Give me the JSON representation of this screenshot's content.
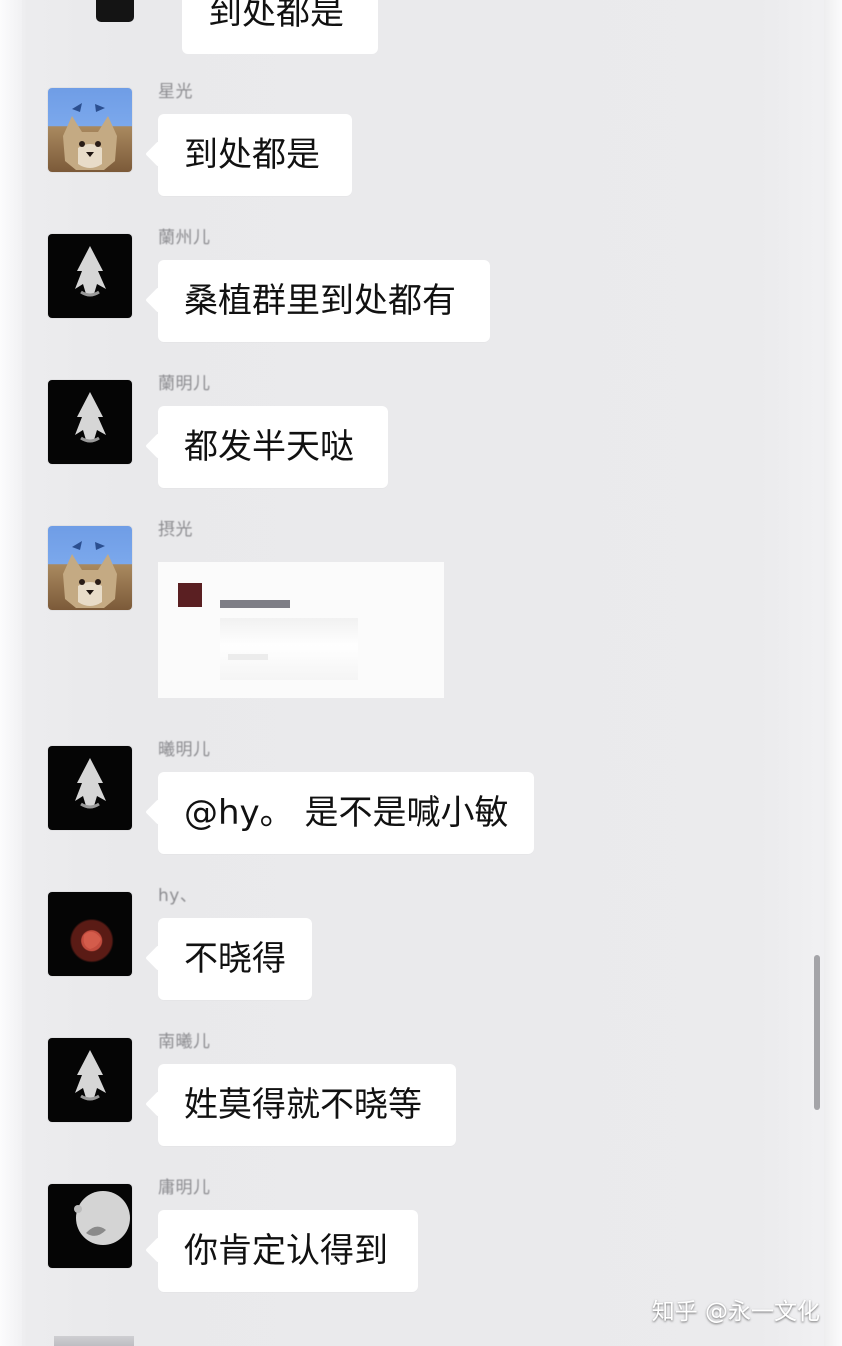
{
  "chat": {
    "partial_top_message": {
      "text": "到处都是"
    },
    "messages": [
      {
        "sender": "星光",
        "text": "到处都是",
        "avatar_icon": "dog-avatar-icon"
      },
      {
        "sender": "蘭州儿",
        "text": "桑植群里到处都有",
        "avatar_icon": "hooded-figure-avatar-icon"
      },
      {
        "sender": "蘭明儿",
        "text": "都发半天哒",
        "avatar_icon": "hooded-figure-avatar-icon"
      },
      {
        "sender": "摂光",
        "text": "",
        "avatar_icon": "dog-avatar-icon",
        "type": "image"
      },
      {
        "sender": "曦明儿",
        "text": "@hy。 是不是喊小敏",
        "avatar_icon": "hooded-figure-avatar-icon"
      },
      {
        "sender": "hy、",
        "text": "不晓得",
        "avatar_icon": "red-glow-avatar-icon"
      },
      {
        "sender": "南曦儿",
        "text": "姓莫得就不晓等",
        "avatar_icon": "hooded-figure-avatar-icon"
      },
      {
        "sender": "庸明儿",
        "text": "你肯定认得到",
        "avatar_icon": "moon-avatar-icon"
      }
    ]
  },
  "watermark": {
    "text": "知乎 @永一文化"
  },
  "colors": {
    "background": "#ebebed",
    "bubble": "#ffffff",
    "text": "#111111",
    "sender_text": "#8c8c90",
    "scrollbar": "#a4a4a8"
  }
}
